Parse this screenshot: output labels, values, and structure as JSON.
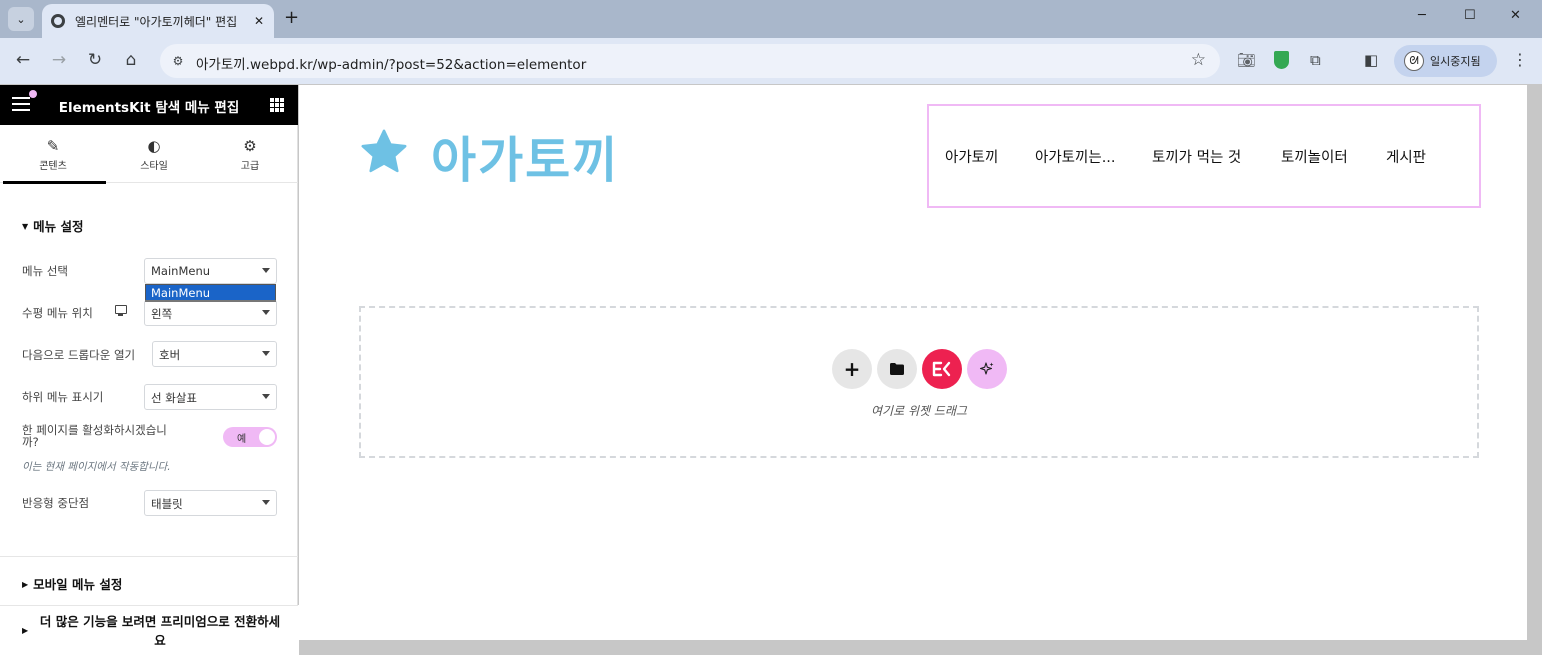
{
  "browser": {
    "tab_title": "엘리멘터로 \"아가토끼헤더\" 편집",
    "tab_close": "✕",
    "new_tab": "+",
    "url": "아가토끼.webpd.kr/wp-admin/?post=52&action=elementor",
    "profile_label": "일시중지됨",
    "window_controls": {
      "minimize": "─",
      "maximize": "☐",
      "close": "✕"
    }
  },
  "panel": {
    "title": "ElementsKit 탐색 메뉴 편집",
    "tabs": [
      {
        "label": "콘텐츠",
        "icon": "pencil-icon",
        "active": true
      },
      {
        "label": "스타일",
        "icon": "contrast-icon",
        "active": false
      },
      {
        "label": "고급",
        "icon": "gear-icon",
        "active": false
      }
    ],
    "section_menu_settings": "메뉴 설정",
    "controls": {
      "menu_select": {
        "label": "메뉴 선택",
        "value": "MainMenu",
        "dropdown_option": "MainMenu"
      },
      "horizontal_position": {
        "label": "수평 메뉴 위치",
        "value": "왼쪽"
      },
      "dropdown_open": {
        "label": "다음으로 드롭다운 열기",
        "value": "호버"
      },
      "submenu_indicator": {
        "label": "하위 메뉴 표시기",
        "value": "선 화살표"
      },
      "one_page": {
        "label": "한 페이지를 활성화하시겠습니까?",
        "toggle_text": "예",
        "enabled": true
      },
      "one_page_note": "이는 현재 페이지에서 작동합니다.",
      "breakpoint": {
        "label": "반응형 중단점",
        "value": "태블릿"
      }
    },
    "section_mobile": "모바일 메뉴 설정",
    "promo_text": "더 많은 기능을 보려면 프리미엄으로 전환하세요"
  },
  "canvas": {
    "logo_text": "아가토끼",
    "nav_items": [
      "아가토끼",
      "아가토끼는...",
      "토끼가 먹는 것",
      "토끼놀이터",
      "게시판"
    ],
    "drop_text": "여기로 위젯 드래그",
    "buttons": [
      "add-section",
      "template-library",
      "elementskit",
      "ai-assistant"
    ]
  },
  "colors": {
    "accent_pink": "#f0b9f5",
    "logo_blue": "#6ec1e4",
    "ek_red": "#ed2150",
    "chrome_tab": "#dfe7f5",
    "chrome_bar": "#a9b7cb"
  }
}
